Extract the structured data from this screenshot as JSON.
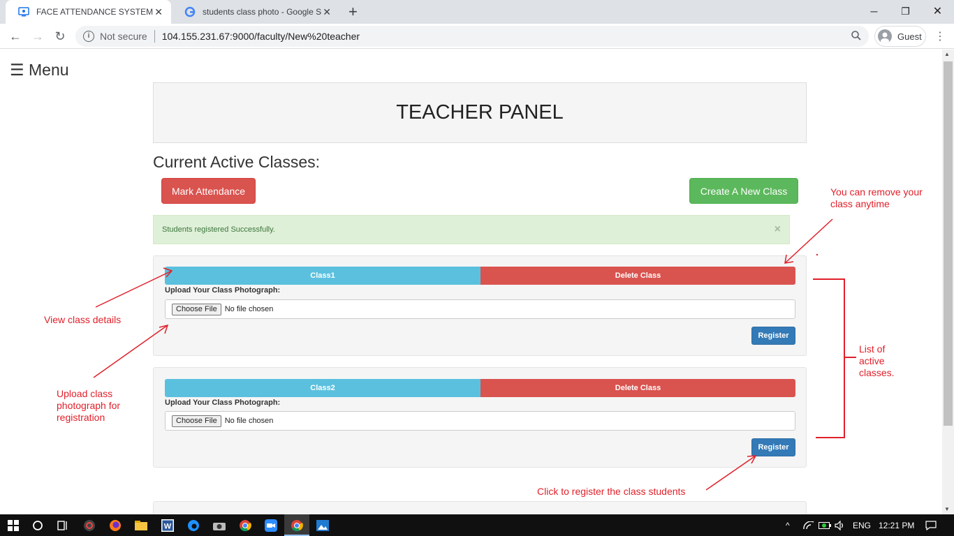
{
  "browser": {
    "tabs": [
      {
        "title": "FACE ATTENDANCE SYSTEM",
        "active": true
      },
      {
        "title": "students class photo - Google Se",
        "active": false
      }
    ],
    "new_tab_glyph": "+",
    "security_label": "Not secure",
    "url": "104.155.231.67:9000/faculty/New%20teacher",
    "profile_label": "Guest"
  },
  "page": {
    "menu_label": "☰ Menu",
    "panel_title": "TEACHER PANEL",
    "section_title": "Current Active Classes:",
    "mark_attendance_label": "Mark Attendance",
    "create_class_label": "Create A New Class",
    "alert_message": "Students registered Successfully.",
    "alert_close": "×",
    "classes": [
      {
        "name": "Class1",
        "delete_label": "Delete Class",
        "upload_label": "Upload Your Class Photograph:",
        "choose_file_label": "Choose File",
        "file_status": "No file chosen",
        "register_label": "Register"
      },
      {
        "name": "Class2",
        "delete_label": "Delete Class",
        "upload_label": "Upload Your Class Photograph:",
        "choose_file_label": "Choose File",
        "file_status": "No file chosen",
        "register_label": "Register"
      }
    ]
  },
  "annotations": {
    "view_details": "View class details",
    "upload_photo": "Upload class photograph for registration",
    "remove_class": "You can remove your class anytime",
    "active_list": "List of active classes.",
    "register_students": "Click to register the class students"
  },
  "taskbar": {
    "language": "ENG",
    "time": "12:21 PM"
  },
  "colors": {
    "danger": "#d9534f",
    "success": "#5cb85c",
    "info": "#5bc0de",
    "primary": "#337ab7",
    "annotation": "#e0202a"
  }
}
